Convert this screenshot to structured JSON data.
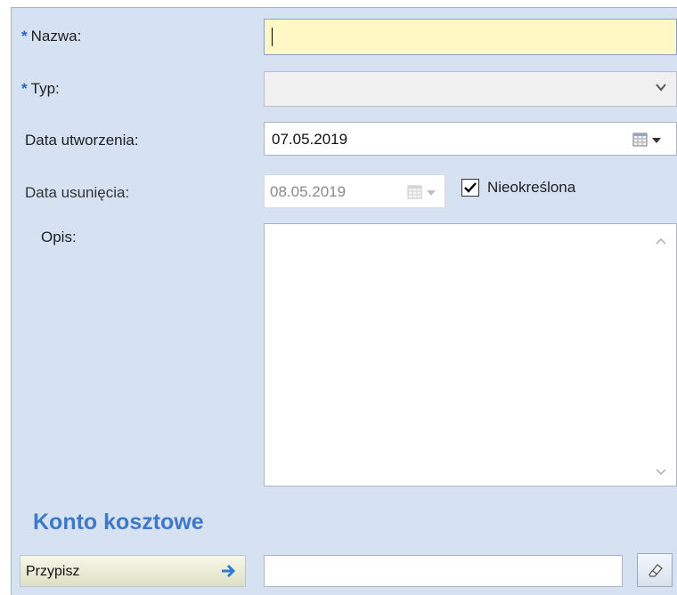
{
  "fields": {
    "name": {
      "label": "Nazwa:",
      "required_mark": "*",
      "value": ""
    },
    "type": {
      "label": "Typ:",
      "required_mark": "*",
      "selected": ""
    },
    "created": {
      "label": "Data utworzenia:",
      "value": "07.05.2019"
    },
    "deleted": {
      "label": "Data usunięcia:",
      "value": "08.05.2019",
      "disabled": true
    },
    "undefined_checkbox": {
      "label": "Nieokreślona",
      "checked": true
    },
    "description": {
      "label": "Opis:",
      "value": ""
    }
  },
  "cost_account": {
    "heading": "Konto kosztowe",
    "assign_label": "Przypisz",
    "value": ""
  },
  "icons": [
    "required-asterisk-icon",
    "chevron-down-icon",
    "calendar-icon",
    "checkmark-icon",
    "scroll-up-icon",
    "scroll-down-icon",
    "arrow-right-icon",
    "eraser-icon"
  ],
  "colors": {
    "panel_bg": "#d6e2f2",
    "required": "#2a62c6",
    "heading": "#3f78c5",
    "active_field": "#fff8c4",
    "arrow": "#2e7cd6"
  }
}
